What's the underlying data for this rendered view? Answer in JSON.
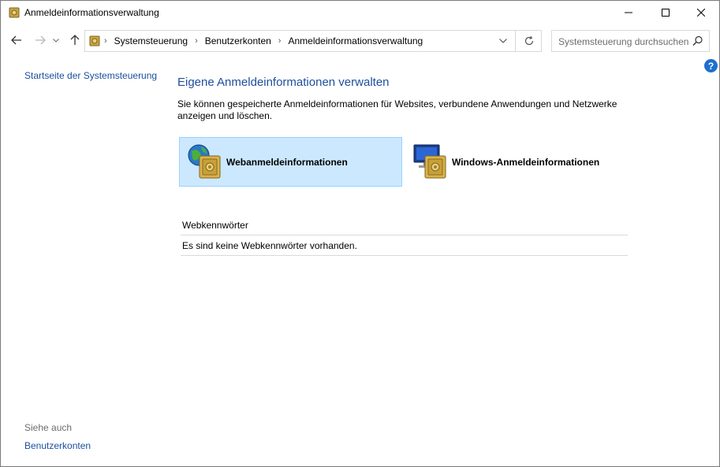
{
  "window": {
    "title": "Anmeldeinformationsverwaltung"
  },
  "address": {
    "crumbs": [
      "Systemsteuerung",
      "Benutzerkonten",
      "Anmeldeinformationsverwaltung"
    ],
    "search_placeholder": "Systemsteuerung durchsuchen"
  },
  "sidebar": {
    "home_link": "Startseite der Systemsteuerung",
    "see_also_heading": "Siehe auch",
    "see_also_link": "Benutzerkonten"
  },
  "main": {
    "title": "Eigene Anmeldeinformationen verwalten",
    "description": "Sie können gespeicherte Anmeldeinformationen für Websites, verbundene Anwendungen und Netzwerke anzeigen und löschen.",
    "tiles": [
      {
        "label": "Webanmeldeinformationen",
        "selected": true,
        "icon": "globe-vault-icon"
      },
      {
        "label": "Windows-Anmeldeinformationen",
        "selected": false,
        "icon": "monitor-vault-icon"
      }
    ],
    "section_heading": "Webkennwörter",
    "empty_message": "Es sind keine Webkennwörter vorhanden."
  },
  "colors": {
    "link": "#1a4e9c",
    "selected_tile": "#cce8ff",
    "help": "#1e6fce"
  }
}
